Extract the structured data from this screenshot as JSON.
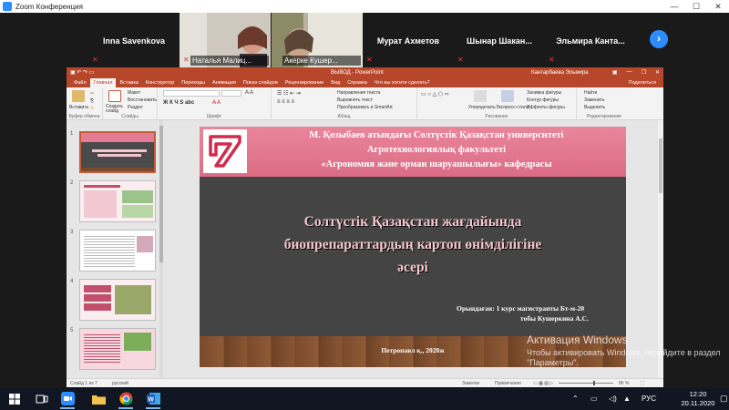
{
  "zoom": {
    "window_title": "Zoom Конференция",
    "participants": [
      {
        "name": "Inna Savenkova",
        "muted": true,
        "video": false,
        "active": false
      },
      {
        "name": "Наталья Малиц...",
        "muted": true,
        "video": true,
        "active": false
      },
      {
        "name": "Акерке Кушер...",
        "muted": false,
        "video": true,
        "active": true
      },
      {
        "name": "Мурат Ахметов",
        "muted": true,
        "video": false,
        "active": false
      },
      {
        "name": "Шынар Шакан...",
        "muted": true,
        "video": false,
        "active": false
      },
      {
        "name": "Эльмира Канта...",
        "muted": true,
        "video": false,
        "active": false
      }
    ],
    "next_page_icon": "chevron-right-icon"
  },
  "ppt": {
    "title": "ВЫВОД - PowerPoint",
    "user": "Кантарбаева Эльмира",
    "tabs": [
      "Файл",
      "Главная",
      "Вставка",
      "Конструктор",
      "Переходы",
      "Анимация",
      "Показ слайдов",
      "Рецензирование",
      "Вид",
      "Справка",
      "Что вы хотите сделать?"
    ],
    "selected_tab": "Главная",
    "share": "Поделиться",
    "ribbon": {
      "paste": "Вставить",
      "clipboard_group": "Буфер обмена",
      "new_slide": "Создать слайд",
      "layout": "Макет",
      "reset": "Восстановить",
      "section": "Раздел",
      "slides_group": "Слайды",
      "font_group": "Шрифт",
      "paragraph_group": "Абзац",
      "text_direction": "Направление текста",
      "align_text": "Выровнять текст",
      "smartart": "Преобразовать в SmartArt",
      "arrange": "Упорядочить",
      "quick_styles": "Экспресс-стили",
      "drawing_group": "Рисование",
      "shape_fill": "Заливка фигуры",
      "shape_outline": "Контур фигуры",
      "shape_effects": "Эффекты фигуры",
      "find": "Найти",
      "replace": "Заменить",
      "select": "Выделить",
      "editing_group": "Редактирование"
    },
    "thumbnails": [
      "1",
      "2",
      "3",
      "4",
      "5"
    ],
    "selected_slide": "1",
    "slide": {
      "header_lines": [
        "М. Қозыбаев атындағы Солтүстік Қазақстан университеті",
        "Агротехнологиялық факультеті",
        "«Агрономия және орман шаруашылығы» кафедрасы"
      ],
      "title_lines": [
        "Солтүстік Қазақстан жағдайында",
        "биопрепараттардың картоп өнімділігіне",
        "әсері"
      ],
      "author_lines": [
        "Орындаған: 1 курс магистранты Бт-м-20",
        "тобы  Кушеркина А.С."
      ],
      "footer": "Петропавл қ., 2020ж"
    },
    "status": {
      "slide_info": "Слайд 1 из 7",
      "language": "русский",
      "notes": "Заметки",
      "comments": "Примечания",
      "zoom": "86 %"
    }
  },
  "watermark": {
    "line1": "Активация Windows",
    "line2": "Чтобы активировать Windows, перейдите в раздел \"Параметры\"."
  },
  "taskbar": {
    "apps": [
      "windows-start-icon",
      "task-view-icon",
      "zoom-app-icon",
      "file-explorer-icon",
      "chrome-icon",
      "word-icon"
    ],
    "language": "РУС",
    "time": "12:20",
    "date": "20.11.2020"
  }
}
